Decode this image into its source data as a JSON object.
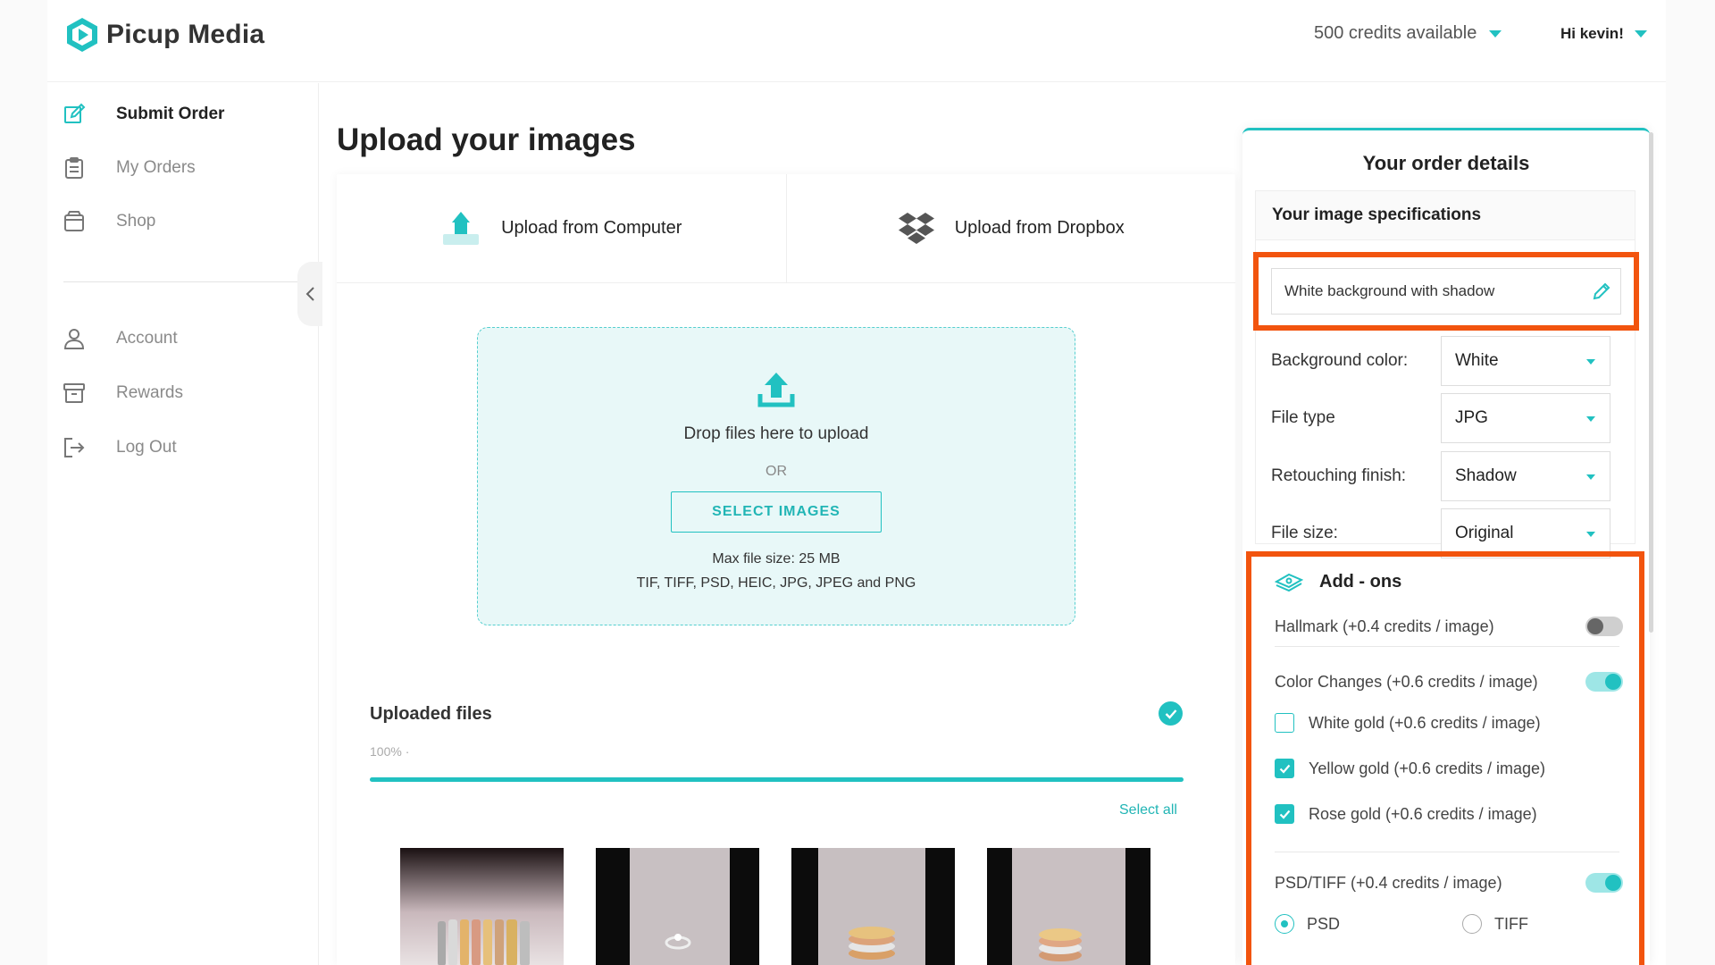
{
  "app": {
    "logo_text": "Picup Media"
  },
  "header": {
    "credits": "500 credits available",
    "greeting": "Hi kevin!"
  },
  "sidebar": {
    "items": [
      {
        "label": "Submit Order",
        "icon": "edit-icon"
      },
      {
        "label": "My Orders",
        "icon": "clipboard-icon"
      },
      {
        "label": "Shop",
        "icon": "shop-icon"
      },
      {
        "label": "Account",
        "icon": "user-icon"
      },
      {
        "label": "Rewards",
        "icon": "archive-icon"
      },
      {
        "label": "Log Out",
        "icon": "logout-icon"
      }
    ]
  },
  "main": {
    "title": "Upload your images",
    "tabs": [
      {
        "label": "Upload from Computer"
      },
      {
        "label": "Upload from Dropbox"
      }
    ],
    "dropzone": {
      "text": "Drop files here to upload",
      "or": "OR",
      "button": "SELECT IMAGES",
      "max_size": "Max file size: 25 MB",
      "types": "TIF, TIFF, PSD, HEIC, JPG, JPEG and PNG"
    },
    "uploaded": {
      "title": "Uploaded files",
      "progress_text": "100%  ·",
      "progress": 1.0,
      "select_all": "Select all"
    }
  },
  "order": {
    "title": "Your order details",
    "spec_title": "Your image specifications",
    "preset": "White background with shadow",
    "specs": [
      {
        "label": "Background color:",
        "value": "White"
      },
      {
        "label": "File type",
        "value": "JPG"
      },
      {
        "label": "Retouching finish:",
        "value": "Shadow"
      },
      {
        "label": "File size:",
        "value": "Original"
      }
    ],
    "addons": {
      "title": "Add - ons",
      "hallmark": {
        "label": "Hallmark (+0.4 credits / image)",
        "on": false
      },
      "color_changes": {
        "label": "Color Changes (+0.6 credits / image)",
        "on": true
      },
      "options": [
        {
          "label": "White gold (+0.6 credits / image)",
          "checked": false
        },
        {
          "label": "Yellow gold (+0.6 credits / image)",
          "checked": true
        },
        {
          "label": "Rose gold (+0.6 credits / image)",
          "checked": true
        }
      ],
      "psd_tiff": {
        "label": "PSD/TIFF (+0.4 credits / image)",
        "on": true
      },
      "formats": [
        {
          "label": "PSD",
          "checked": true
        },
        {
          "label": "TIFF",
          "checked": false
        }
      ]
    }
  },
  "colors": {
    "accent": "#21c1c1",
    "highlight": "#f2540e"
  }
}
